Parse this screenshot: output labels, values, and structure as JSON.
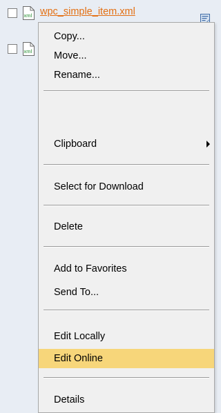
{
  "files": [
    {
      "checkbox_checked": false,
      "icon": "xml-file-icon",
      "icon_text": "xml",
      "name": "wpc_simple_item.xml"
    },
    {
      "checkbox_checked": false,
      "icon": "xml-file-icon",
      "icon_text": "xml"
    }
  ],
  "context_menu": {
    "items": [
      {
        "label": "Copy..."
      },
      {
        "label": "Move..."
      },
      {
        "label": "Rename..."
      },
      {
        "label": "Clipboard",
        "has_submenu": true
      },
      {
        "label": "Select for Download"
      },
      {
        "label": "Delete"
      },
      {
        "label": "Add to Favorites"
      },
      {
        "label": "Send To..."
      },
      {
        "label": "Edit Locally"
      },
      {
        "label": "Edit Online",
        "highlighted": true
      },
      {
        "label": "Details"
      }
    ]
  },
  "colors": {
    "link": "#e36f12",
    "highlight": "#f7d67a",
    "menu_background": "#f0f0f0",
    "page_background": "#e8edf4",
    "xml_icon_text": "#1f8a2b"
  }
}
